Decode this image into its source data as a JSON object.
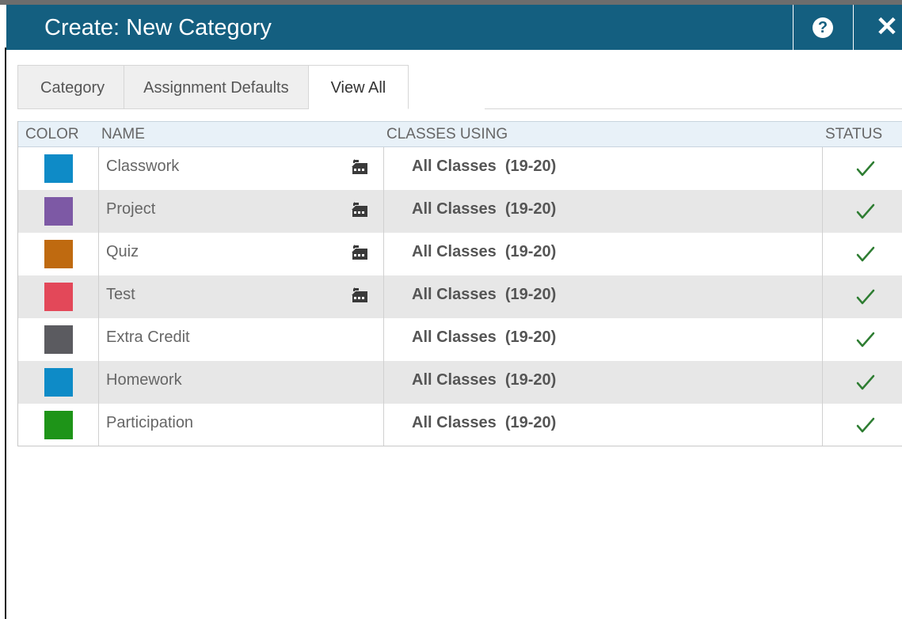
{
  "window": {
    "title": "Create: New Category",
    "help_glyph": "?",
    "close_glyph": "✕"
  },
  "tabs": [
    {
      "label": "Category",
      "active": false
    },
    {
      "label": "Assignment Defaults",
      "active": false
    },
    {
      "label": "View All",
      "active": true
    }
  ],
  "table": {
    "columns": [
      "COLOR",
      "NAME",
      "CLASSES USING",
      "STATUS"
    ],
    "rows": [
      {
        "color": "#0e8bc7",
        "name": "Classwork",
        "school_icon": true,
        "classes": "All Classes  (19-20)",
        "status": "active"
      },
      {
        "color": "#7d59a5",
        "name": "Project",
        "school_icon": true,
        "classes": "All Classes  (19-20)",
        "status": "active"
      },
      {
        "color": "#bf6a10",
        "name": "Quiz",
        "school_icon": true,
        "classes": "All Classes  (19-20)",
        "status": "active"
      },
      {
        "color": "#e34859",
        "name": "Test",
        "school_icon": true,
        "classes": "All Classes  (19-20)",
        "status": "active"
      },
      {
        "color": "#5b5b60",
        "name": "Extra Credit",
        "school_icon": false,
        "classes": "All Classes  (19-20)",
        "status": "active"
      },
      {
        "color": "#0e8bc7",
        "name": "Homework",
        "school_icon": false,
        "classes": "All Classes  (19-20)",
        "status": "active"
      },
      {
        "color": "#1e9418",
        "name": "Participation",
        "school_icon": false,
        "classes": "All Classes  (19-20)",
        "status": "active"
      }
    ]
  },
  "colors": {
    "titlebar": "#145f80",
    "header_bg": "#e8f1f8",
    "alt_row": "#e7e7e7",
    "check": "#2e7d32"
  },
  "icons": {
    "school": "school-icon",
    "status": "check-icon"
  }
}
